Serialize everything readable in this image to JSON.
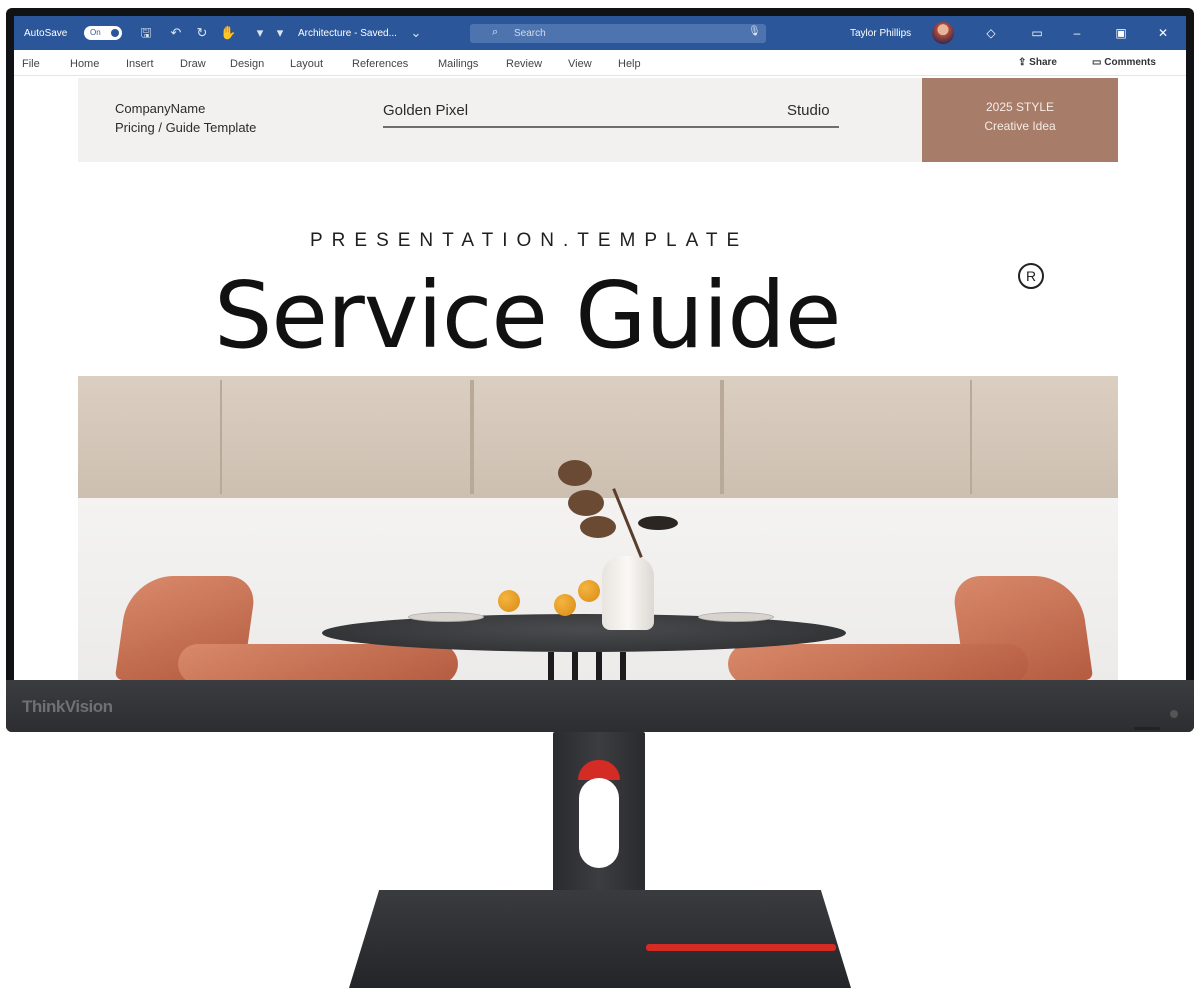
{
  "window": {
    "autosave_label": "AutoSave",
    "autosave_state": "On",
    "doc_title": "Architecture - Saved...",
    "search_placeholder": "Search",
    "user_name": "Taylor Phillips",
    "accent_color": "#2b579a"
  },
  "menu": {
    "items": [
      "File",
      "Home",
      "Insert",
      "Draw",
      "Design",
      "Layout",
      "References",
      "Mailings",
      "Review",
      "View",
      "Help"
    ],
    "share_label": "Share",
    "comments_label": "Comments"
  },
  "document": {
    "header": {
      "company_line1": "CompanyName",
      "company_line2": "Pricing / Guide Template",
      "center_left": "Golden Pixel",
      "center_right": "Studio",
      "box_line1": "2025 STYLE",
      "box_line2": "Creative Idea",
      "box_color": "#a77c68"
    },
    "kicker": "PRESENTATION.TEMPLATE",
    "title": "Service Guide",
    "registered_mark": "R"
  },
  "monitor": {
    "brand": "ThinkVision",
    "accent_red": "#d42b24"
  },
  "icons": {
    "save": "save-icon",
    "undo": "undo-icon",
    "redo": "redo-icon",
    "search": "search-icon",
    "mic": "mic-icon",
    "minimize": "minimize-icon",
    "maximize": "maximize-icon",
    "close": "close-icon"
  }
}
